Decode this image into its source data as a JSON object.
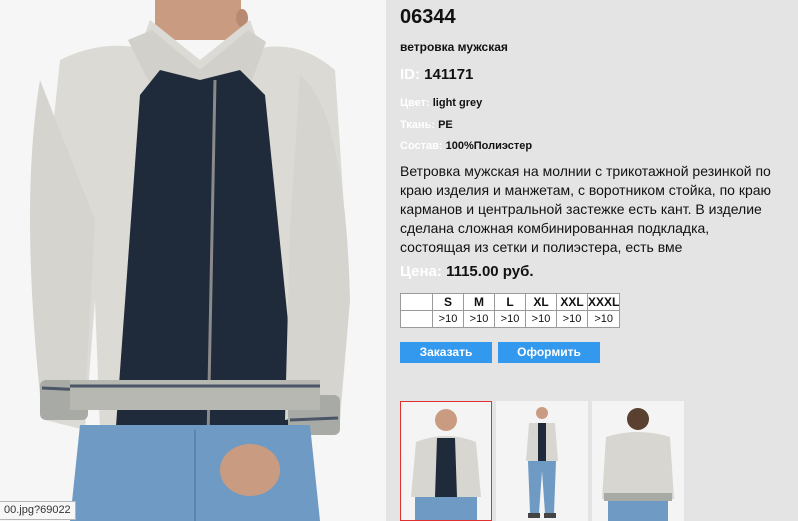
{
  "product": {
    "sku": "06344",
    "subtitle": "ветровка мужская",
    "id_label": "ID:",
    "id_value": "141171",
    "color_label": "Цвет:",
    "color_value": "light grey",
    "fabric_label": "Ткань:",
    "fabric_value": "PE",
    "composition_label": "Состав:",
    "composition_value": "100%Полиэстер",
    "description": "Ветровка мужская на молнии с трикотажной резинкой по краю изделия и манжетам, с воротником стойка, по краю карманов и центральной застежке есть кант. В изделие сделана сложная комбинированная подкладка, состоящая из  сетки и полиэстера, есть вме",
    "price_label": "Цена:",
    "price_value": "1115.00 руб."
  },
  "sizes": [
    {
      "size": "S",
      "stock": ">10"
    },
    {
      "size": "M",
      "stock": ">10"
    },
    {
      "size": "L",
      "stock": ">10"
    },
    {
      "size": "XL",
      "stock": ">10"
    },
    {
      "size": "XXL",
      "stock": ">10"
    },
    {
      "size": "XXXL",
      "stock": ">10"
    }
  ],
  "buttons": {
    "order": "Заказать",
    "checkout": "Оформить"
  },
  "status_tip": "00.jpg?69022",
  "colors": {
    "accent_button": "#3399ee",
    "active_thumb_border": "#e03030",
    "label_text": "#ffffff",
    "background": "#e4e4e4"
  },
  "icons": {
    "main_photo": "product-photo-front",
    "thumbnails": [
      "product-thumb-front-closeup",
      "product-thumb-full-body",
      "product-thumb-back"
    ]
  }
}
